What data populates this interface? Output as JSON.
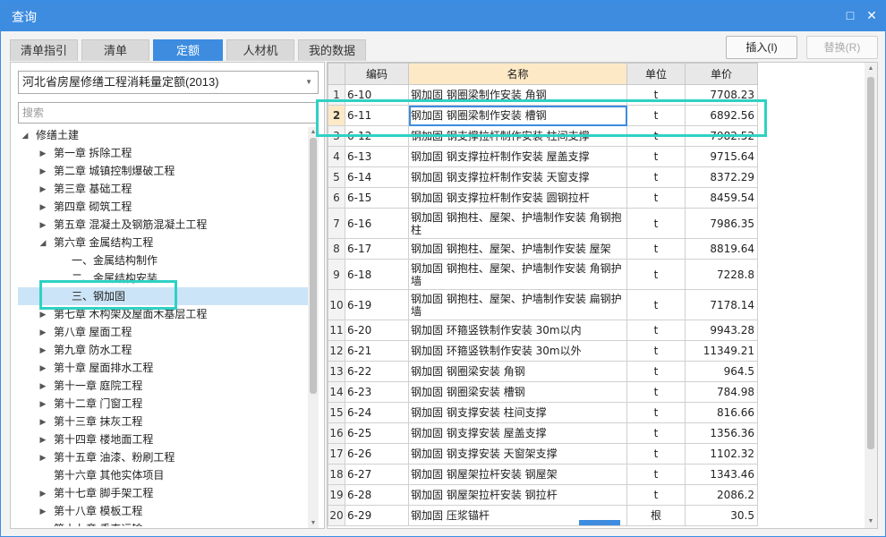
{
  "window": {
    "title": "查询"
  },
  "title_buttons": {
    "maximize": "□",
    "close": "✕"
  },
  "tabs": [
    {
      "label": "清单指引"
    },
    {
      "label": "清单"
    },
    {
      "label": "定额"
    },
    {
      "label": "人材机"
    },
    {
      "label": "我的数据"
    }
  ],
  "actions": {
    "insert": "插入(I)",
    "replace": "替换(R)"
  },
  "left": {
    "library": "河北省房屋修缮工程消耗量定额(2013)",
    "search_placeholder": "搜索"
  },
  "tree": [
    {
      "label": "修缮土建",
      "expand": "◢"
    },
    {
      "label": "第一章 拆除工程",
      "expand": "▶"
    },
    {
      "label": "第二章 城镇控制爆破工程",
      "expand": "▶"
    },
    {
      "label": "第三章 基础工程",
      "expand": "▶"
    },
    {
      "label": "第四章 砌筑工程",
      "expand": "▶"
    },
    {
      "label": "第五章 混凝土及钢筋混凝土工程",
      "expand": "▶"
    },
    {
      "label": "第六章 金属结构工程",
      "expand": "◢"
    },
    {
      "label": "一、金属结构制作",
      "expand": ""
    },
    {
      "label": "二、金属结构安装",
      "expand": ""
    },
    {
      "label": "三、钢加固",
      "expand": ""
    },
    {
      "label": "第七章 木构架及屋面木基层工程",
      "expand": "▶"
    },
    {
      "label": "第八章 屋面工程",
      "expand": "▶"
    },
    {
      "label": "第九章 防水工程",
      "expand": "▶"
    },
    {
      "label": "第十章 屋面排水工程",
      "expand": "▶"
    },
    {
      "label": "第十一章 庭院工程",
      "expand": "▶"
    },
    {
      "label": "第十二章 门窗工程",
      "expand": "▶"
    },
    {
      "label": "第十三章 抹灰工程",
      "expand": "▶"
    },
    {
      "label": "第十四章 楼地面工程",
      "expand": "▶"
    },
    {
      "label": "第十五章 油漆、粉刷工程",
      "expand": "▶"
    },
    {
      "label": "第十六章 其他实体项目",
      "expand": ""
    },
    {
      "label": "第十七章 脚手架工程",
      "expand": "▶"
    },
    {
      "label": "第十八章 模板工程",
      "expand": "▶"
    },
    {
      "label": "第十九章 垂直运输",
      "expand": "▶"
    }
  ],
  "grid": {
    "columns": {
      "code": "编码",
      "name": "名称",
      "unit": "单位",
      "price": "单价"
    },
    "rows": [
      {
        "n": "1",
        "code": "6-10",
        "name": "钢加固 钢圈梁制作安装 角钢",
        "unit": "t",
        "price": "7708.23"
      },
      {
        "n": "2",
        "code": "6-11",
        "name": "钢加固 钢圈梁制作安装 槽钢",
        "unit": "t",
        "price": "6892.56"
      },
      {
        "n": "3",
        "code": "6-12",
        "name": "钢加固 钢支撑拉杆制作安装 柱间支撑",
        "unit": "t",
        "price": "7982.52"
      },
      {
        "n": "4",
        "code": "6-13",
        "name": "钢加固 钢支撑拉杆制作安装 屋盖支撑",
        "unit": "t",
        "price": "9715.64"
      },
      {
        "n": "5",
        "code": "6-14",
        "name": "钢加固 钢支撑拉杆制作安装 天窗支撑",
        "unit": "t",
        "price": "8372.29"
      },
      {
        "n": "6",
        "code": "6-15",
        "name": "钢加固 钢支撑拉杆制作安装 圆钢拉杆",
        "unit": "t",
        "price": "8459.54"
      },
      {
        "n": "7",
        "code": "6-16",
        "name": "钢加固 钢抱柱、屋架、护墙制作安装 角钢抱柱",
        "unit": "t",
        "price": "7986.35"
      },
      {
        "n": "8",
        "code": "6-17",
        "name": "钢加固 钢抱柱、屋架、护墙制作安装 屋架",
        "unit": "t",
        "price": "8819.64"
      },
      {
        "n": "9",
        "code": "6-18",
        "name": "钢加固 钢抱柱、屋架、护墙制作安装 角钢护墙",
        "unit": "t",
        "price": "7228.8"
      },
      {
        "n": "10",
        "code": "6-19",
        "name": "钢加固 钢抱柱、屋架、护墙制作安装 扁钢护墙",
        "unit": "t",
        "price": "7178.14"
      },
      {
        "n": "11",
        "code": "6-20",
        "name": "钢加固 环箍竖铁制作安装 30m以内",
        "unit": "t",
        "price": "9943.28"
      },
      {
        "n": "12",
        "code": "6-21",
        "name": "钢加固 环箍竖铁制作安装 30m以外",
        "unit": "t",
        "price": "11349.21"
      },
      {
        "n": "13",
        "code": "6-22",
        "name": "钢加固 钢圈梁安装 角钢",
        "unit": "t",
        "price": "964.5"
      },
      {
        "n": "14",
        "code": "6-23",
        "name": "钢加固 钢圈梁安装 槽钢",
        "unit": "t",
        "price": "784.98"
      },
      {
        "n": "15",
        "code": "6-24",
        "name": "钢加固 钢支撑安装 柱间支撑",
        "unit": "t",
        "price": "816.66"
      },
      {
        "n": "16",
        "code": "6-25",
        "name": "钢加固 钢支撑安装 屋盖支撑",
        "unit": "t",
        "price": "1356.36"
      },
      {
        "n": "17",
        "code": "6-26",
        "name": "钢加固 钢支撑安装 天窗架支撑",
        "unit": "t",
        "price": "1102.32"
      },
      {
        "n": "18",
        "code": "6-27",
        "name": "钢加固 钢屋架拉杆安装 钢屋架",
        "unit": "t",
        "price": "1343.46"
      },
      {
        "n": "19",
        "code": "6-28",
        "name": "钢加固 钢屋架拉杆安装 钢拉杆",
        "unit": "t",
        "price": "2086.2"
      },
      {
        "n": "20",
        "code": "6-29",
        "name": "钢加固 压浆锚杆",
        "unit": "根",
        "price": "30.5"
      }
    ]
  },
  "colors": {
    "accent": "#3d8ce0",
    "annotation": "#2fd1c4",
    "selection": "#cce4f7",
    "header_highlight": "#fde9c6"
  }
}
